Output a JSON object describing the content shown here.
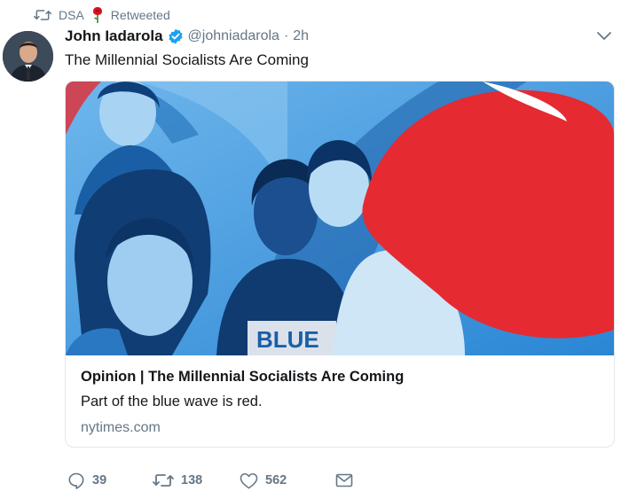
{
  "retweet_context": {
    "icon": "retweet-icon",
    "account": "DSA",
    "emoji": "rose-icon",
    "label": "Retweeted"
  },
  "tweet": {
    "author_name": "John Iadarola",
    "verified": true,
    "handle": "@johniadarola",
    "separator": "·",
    "time": "2h",
    "text": "The Millennial Socialists Are Coming",
    "menu_icon": "chevron-down-icon"
  },
  "card": {
    "title": "Opinion | The Millennial Socialists Are Coming",
    "description": "Part of the blue wave is red.",
    "domain": "nytimes.com",
    "colors": {
      "image_blue": "#2f8fd8",
      "image_red": "#e52a31"
    }
  },
  "actions": {
    "reply": {
      "icon": "reply-icon",
      "count": "39"
    },
    "retweet": {
      "icon": "retweet-icon",
      "count": "138"
    },
    "like": {
      "icon": "heart-icon",
      "count": "562"
    },
    "message": {
      "icon": "envelope-icon"
    }
  },
  "colors": {
    "muted": "#657786",
    "text": "#14171a",
    "verified": "#1da1f2",
    "border": "#e1e8ed"
  }
}
